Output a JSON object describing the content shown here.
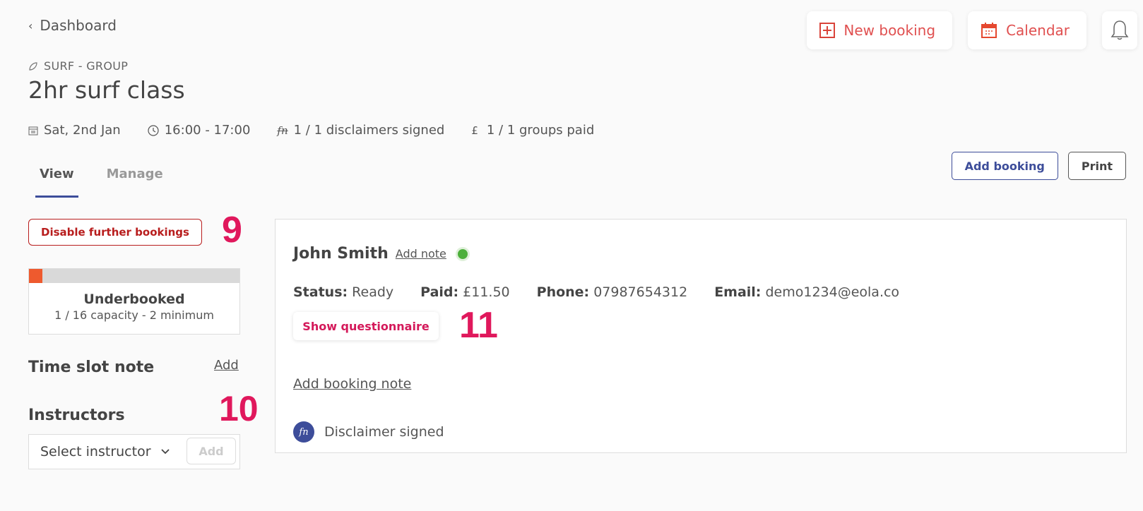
{
  "nav": {
    "back_label": "Dashboard"
  },
  "top_actions": {
    "new_booking": "New booking",
    "calendar": "Calendar",
    "accent_color": "#e05050"
  },
  "header": {
    "category": "SURF - GROUP",
    "title": "2hr surf class",
    "meta": {
      "date": "Sat, 2nd Jan",
      "time": "16:00 - 17:00",
      "disclaimers": "1 / 1 disclaimers signed",
      "currency_symbol": "£",
      "payments": "1 / 1 groups paid"
    }
  },
  "tabs": [
    {
      "label": "View",
      "active": true
    },
    {
      "label": "Manage",
      "active": false
    }
  ],
  "actions": {
    "add_booking": "Add booking",
    "print": "Print"
  },
  "sidebar": {
    "disable_label": "Disable further bookings",
    "capacity": {
      "status": "Underbooked",
      "detail": "1 / 16 capacity - 2 minimum",
      "booked": 1,
      "total": 16,
      "fill_color": "#ee5a2e"
    },
    "time_slot_note": {
      "title": "Time slot note",
      "add_label": "Add"
    },
    "instructors": {
      "title": "Instructors",
      "select_placeholder": "Select instructor",
      "add_label": "Add"
    }
  },
  "annotations": {
    "a9": "9",
    "a10": "10",
    "a11": "11"
  },
  "booking": {
    "name": "John Smith",
    "add_note_label": "Add note",
    "status_label": "Status:",
    "status": "Ready",
    "paid_label": "Paid:",
    "paid": "£11.50",
    "phone_label": "Phone:",
    "phone": "07987654312",
    "email_label": "Email:",
    "email": "demo1234@eola.co",
    "questionnaire_label": "Show questionnaire",
    "booking_note_label": "Add booking note",
    "disclaimer_text": "Disclaimer signed",
    "disclaimer_icon_text": "fn"
  }
}
